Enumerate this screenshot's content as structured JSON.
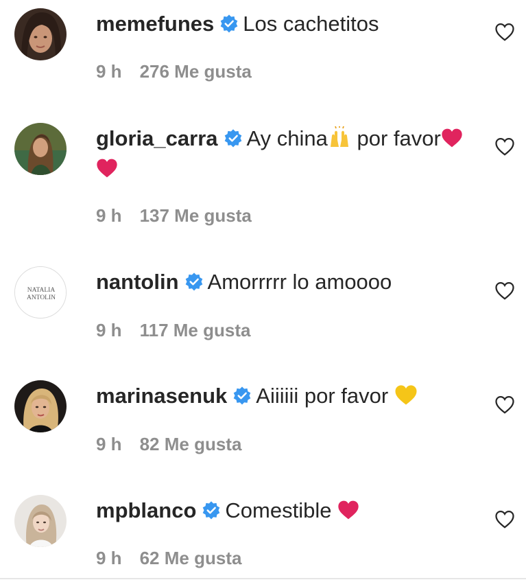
{
  "comments": [
    {
      "username": "memefunes",
      "text": "Los cachetitos",
      "time": "9 h",
      "likes": "276 Me gusta",
      "avatar": "woman-dark-hair-avatar"
    },
    {
      "username": "gloria_carra",
      "text_a": "Ay china",
      "text_b": " por favor",
      "time": "9 h",
      "likes": "137 Me gusta",
      "avatar": "woman-outdoor-avatar"
    },
    {
      "username": "nantolin",
      "text": "Amorrrrr lo amoooo",
      "time": "9 h",
      "likes": "117 Me gusta",
      "avatar": "text-logo-avatar",
      "avatar_line1": "NATALIA",
      "avatar_line2": "ANTOLIN"
    },
    {
      "username": "marinasenuk",
      "text": "Aiiiiii por favor ",
      "time": "9 h",
      "likes": "82 Me gusta",
      "avatar": "woman-blonde-avatar"
    },
    {
      "username": "mpblanco",
      "text": "Comestible ",
      "time": "9 h",
      "likes": "62 Me gusta",
      "avatar": "woman-light-avatar"
    }
  ],
  "colors": {
    "verified": "#3897f0",
    "meta": "#8e8e8e",
    "text": "#262626",
    "heart_red": "#e0245e",
    "heart_yellow": "#f5c518"
  },
  "icons": {
    "verified": "verified-badge-icon",
    "like": "heart-outline-icon",
    "emoji_raised_hands": "raising-hands-emoji",
    "emoji_red_heart": "red-heart-emoji",
    "emoji_yellow_heart": "yellow-heart-emoji"
  }
}
